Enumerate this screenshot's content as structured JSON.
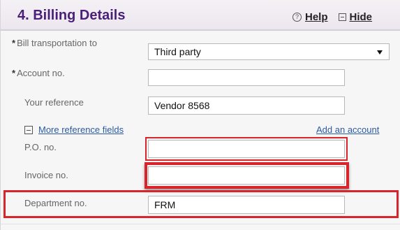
{
  "header": {
    "title": "4. Billing Details",
    "help_label": "Help",
    "hide_label": "Hide",
    "help_icon": "question-circle-icon",
    "hide_icon": "collapse-square-icon"
  },
  "fields": {
    "bill_transportation": {
      "required_mark": "*",
      "label": "Bill transportation to",
      "value": "Third party"
    },
    "account_no": {
      "required_mark": "*",
      "label": "Account no.",
      "value": ""
    },
    "your_reference": {
      "label": "Your reference",
      "value": "Vendor 8568"
    },
    "po_no": {
      "label": "P.O. no.",
      "value": ""
    },
    "invoice_no": {
      "label": "Invoice no.",
      "value": ""
    },
    "department_no": {
      "label": "Department no.",
      "value": "FRM"
    }
  },
  "links": {
    "more_reference_fields": "More reference fields",
    "add_account": "Add an account"
  },
  "colors": {
    "title": "#4a1f78",
    "link": "#2c5aa0",
    "highlight": "#d8252b"
  }
}
